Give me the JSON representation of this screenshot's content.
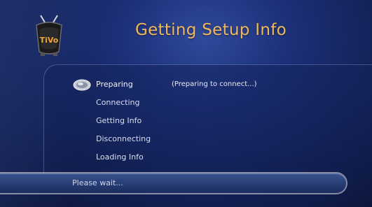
{
  "logo": {
    "text": "TiVo",
    "icon": "tivo-logo-icon"
  },
  "title": "Getting Setup Info",
  "steps": [
    {
      "label": "Preparing"
    },
    {
      "label": "Connecting"
    },
    {
      "label": "Getting Info"
    },
    {
      "label": "Disconnecting"
    },
    {
      "label": "Loading Info"
    }
  ],
  "current_step_status": "(Preparing to connect...)",
  "wait_message": "Please wait...",
  "colors": {
    "title": "#f0b85a",
    "background": "#1c2f78",
    "bar": "#2a4078"
  }
}
